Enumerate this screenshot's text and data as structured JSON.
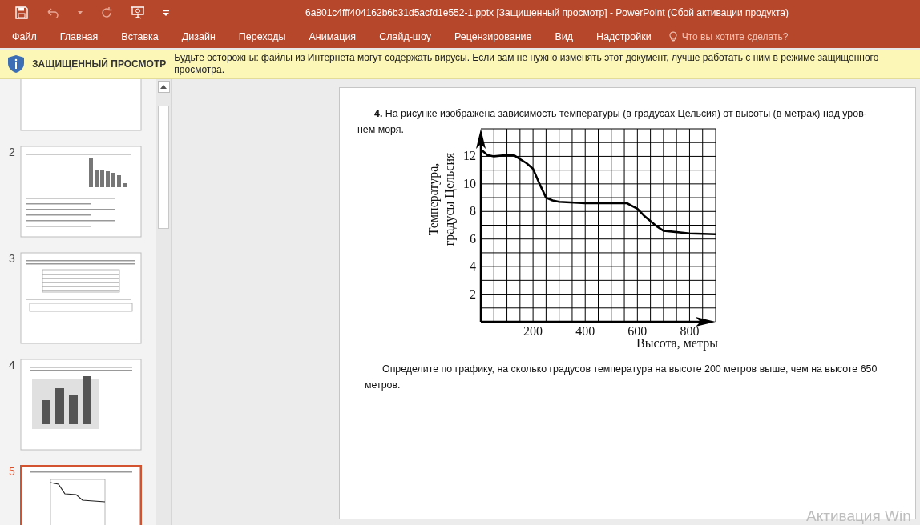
{
  "window": {
    "title": "6a801c4fff404162b6b31d5acfd1e552-1.pptx [Защищенный просмотр] - PowerPoint (Сбой активации продукта)"
  },
  "ribbon_tabs": [
    "Файл",
    "Главная",
    "Вставка",
    "Дизайн",
    "Переходы",
    "Анимация",
    "Слайд-шоу",
    "Рецензирование",
    "Вид",
    "Надстройки"
  ],
  "tell_me": {
    "placeholder": "Что вы хотите сделать?"
  },
  "protected_view": {
    "title": "ЗАЩИЩЕННЫЙ ПРОСМОТР",
    "message": "Будьте осторожны: файлы из Интернета могут содержать вирусы. Если вам не нужно изменять этот документ, лучше работать с ним в режиме защищенного просмотра."
  },
  "thumbnails": [
    {
      "kind": "blank",
      "selected": false
    },
    {
      "number": "2",
      "kind": "bars",
      "selected": false
    },
    {
      "number": "3",
      "kind": "table",
      "selected": false
    },
    {
      "number": "4",
      "kind": "columns",
      "selected": false
    },
    {
      "number": "5",
      "kind": "graph",
      "selected": true
    }
  ],
  "slide": {
    "intro_lines": [
      "**4.** На рисунке изображена зависимость температуры (в градусах Цельсия) от высоты (в метрах) над уров-",
      "нем моря."
    ],
    "chart_data": {
      "type": "line",
      "xlabel": "Высота, метры",
      "ylabel": "Температура, градусы Цельсия",
      "x": [
        0,
        25,
        50,
        100,
        125,
        150,
        175,
        200,
        225,
        250,
        275,
        300,
        400,
        500,
        560,
        600,
        625,
        650,
        675,
        700,
        800,
        900
      ],
      "series": [
        {
          "color": "#000000",
          "values": [
            12.5,
            12.1,
            12.0,
            12.1,
            12.1,
            11.8,
            11.5,
            11.1,
            10,
            9,
            8.8,
            8.7,
            8.6,
            8.6,
            8.6,
            8.2,
            7.7,
            7.3,
            6.9,
            6.6,
            6.4,
            6.35
          ]
        }
      ],
      "grid": true,
      "xlim": [
        0,
        900
      ],
      "ylim": [
        0,
        14
      ],
      "xticks": [
        200,
        400,
        600,
        800
      ],
      "yticks": [
        2,
        4,
        6,
        8,
        10,
        12
      ]
    },
    "question_lines": [
      "Определите по графику, на сколько градусов температура на высоте 200 метров выше, чем на высоте 650",
      "метров."
    ]
  },
  "activation_notice": "Активация Win"
}
